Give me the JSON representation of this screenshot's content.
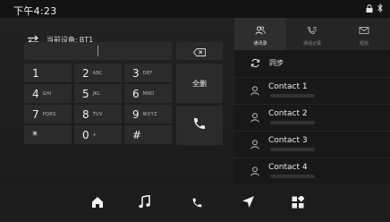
{
  "status_bar": {
    "time": "下午4:23"
  },
  "device": {
    "label": "当前设备:",
    "value": "BT1"
  },
  "keypad": [
    {
      "digit": "1",
      "letters": ""
    },
    {
      "digit": "2",
      "letters": "ABC"
    },
    {
      "digit": "3",
      "letters": "DEF"
    },
    {
      "digit": "4",
      "letters": "GHI"
    },
    {
      "digit": "5",
      "letters": "JKL"
    },
    {
      "digit": "6",
      "letters": "MNO"
    },
    {
      "digit": "7",
      "letters": "PQRS"
    },
    {
      "digit": "8",
      "letters": "TUV"
    },
    {
      "digit": "9",
      "letters": "WXYZ"
    },
    {
      "digit": "*",
      "letters": ""
    },
    {
      "digit": "0",
      "letters": "+"
    },
    {
      "digit": "#",
      "letters": ""
    }
  ],
  "actions": {
    "delete_all": "全删"
  },
  "tabs": [
    {
      "label": "通讯录",
      "icon": "contacts-icon",
      "active": true
    },
    {
      "label": "通话记录",
      "icon": "call-log-icon",
      "active": false
    },
    {
      "label": "短信",
      "icon": "sms-icon",
      "active": false
    }
  ],
  "sync": {
    "label": "同步"
  },
  "contacts": [
    {
      "name": "Contact 1"
    },
    {
      "name": "Contact 2"
    },
    {
      "name": "Contact 3"
    },
    {
      "name": "Contact 4"
    }
  ],
  "bottom_nav": [
    "home-icon",
    "music-icon",
    "phone-icon",
    "navigation-icon",
    "apps-icon"
  ]
}
